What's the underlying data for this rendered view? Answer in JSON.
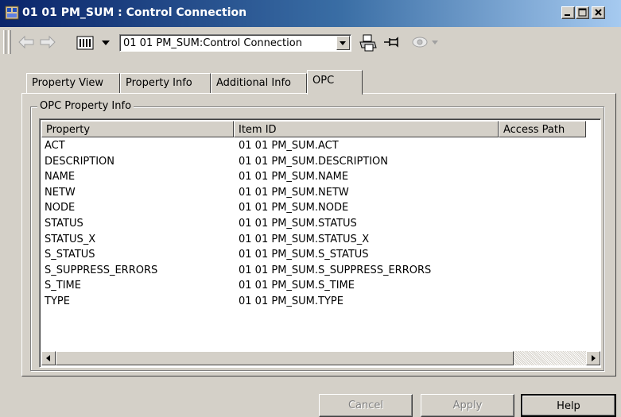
{
  "window": {
    "title": "01 01 PM_SUM : Control Connection"
  },
  "toolbar": {
    "combo_value": "01 01 PM_SUM:Control Connection"
  },
  "tabs": [
    {
      "label": "Property View"
    },
    {
      "label": "Property Info"
    },
    {
      "label": "Additional Info"
    },
    {
      "label": "OPC"
    }
  ],
  "active_tab": "OPC",
  "group": {
    "label": "OPC Property Info"
  },
  "table": {
    "columns": [
      "Property",
      "Item ID",
      "Access Path"
    ],
    "rows": [
      {
        "property": "ACT",
        "item_id": "01 01 PM_SUM.ACT",
        "access_path": ""
      },
      {
        "property": "DESCRIPTION",
        "item_id": "01 01 PM_SUM.DESCRIPTION",
        "access_path": ""
      },
      {
        "property": "NAME",
        "item_id": "01 01 PM_SUM.NAME",
        "access_path": ""
      },
      {
        "property": "NETW",
        "item_id": "01 01 PM_SUM.NETW",
        "access_path": ""
      },
      {
        "property": "NODE",
        "item_id": "01 01 PM_SUM.NODE",
        "access_path": ""
      },
      {
        "property": "STATUS",
        "item_id": "01 01 PM_SUM.STATUS",
        "access_path": ""
      },
      {
        "property": "STATUS_X",
        "item_id": "01 01 PM_SUM.STATUS_X",
        "access_path": ""
      },
      {
        "property": "S_STATUS",
        "item_id": "01 01 PM_SUM.S_STATUS",
        "access_path": ""
      },
      {
        "property": "S_SUPPRESS_ERRORS",
        "item_id": "01 01 PM_SUM.S_SUPPRESS_ERRORS",
        "access_path": ""
      },
      {
        "property": "S_TIME",
        "item_id": "01 01 PM_SUM.S_TIME",
        "access_path": ""
      },
      {
        "property": "TYPE",
        "item_id": "01 01 PM_SUM.TYPE",
        "access_path": ""
      }
    ]
  },
  "buttons": {
    "cancel": "Cancel",
    "apply": "Apply",
    "help": "Help"
  },
  "icons": {
    "app": "app-icon",
    "minimize": "minimize-icon",
    "maximize": "maximize-icon",
    "close": "close-icon",
    "back": "back-arrow-icon",
    "forward": "forward-arrow-icon",
    "faceplate": "faceplate-icon",
    "print": "print-icon",
    "pin": "pin-icon",
    "eye": "eye-icon"
  },
  "colors": {
    "titlebar_start": "#0a246a",
    "titlebar_end": "#a6caf0",
    "face": "#d4d0c8"
  }
}
